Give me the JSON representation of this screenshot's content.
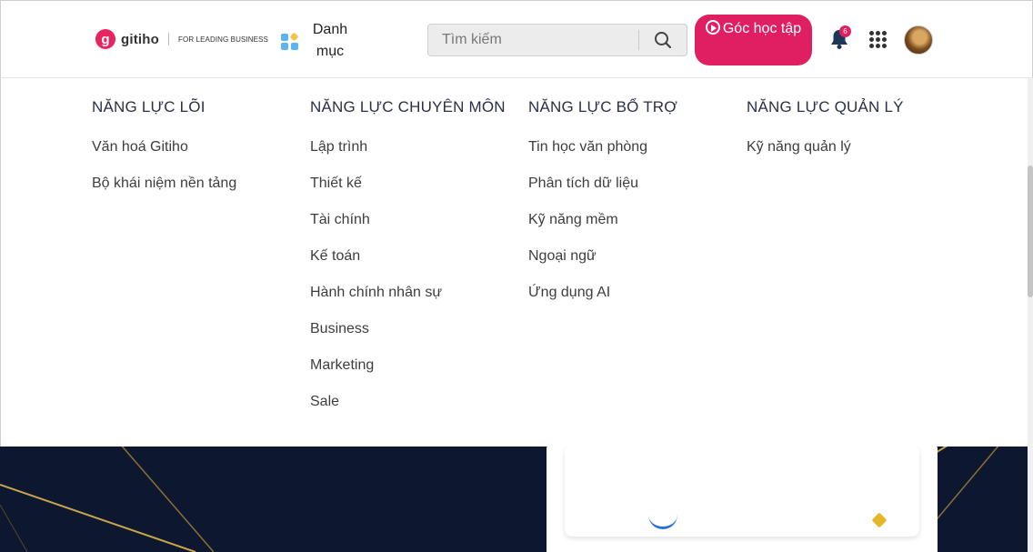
{
  "header": {
    "logo_text": "gitiho",
    "logo_mark": "g",
    "logo_tagline": "FOR LEADING BUSINESS",
    "category_label": "Danh mục",
    "search": {
      "placeholder": "Tìm kiếm",
      "value": ""
    },
    "study_button_label": "Góc học tập",
    "notification_count": "6",
    "icons": {
      "category": "category-grid-icon",
      "search": "search-icon",
      "study": "play-circle-icon",
      "notifications": "bell-icon",
      "apps": "apps-grid-icon"
    },
    "colors": {
      "accent": "#e01f63",
      "category_icon": "#5bb4f3"
    }
  },
  "menu": {
    "columns": [
      {
        "heading": "NĂNG LỰC LÕI",
        "items": [
          "Văn hoá Gitiho",
          "Bộ khái niệm nền tảng"
        ]
      },
      {
        "heading": "NĂNG LỰC CHUYÊN MÔN",
        "items": [
          "Lập trình",
          "Thiết kế",
          "Tài chính",
          "Kế toán",
          "Hành chính nhân sự",
          "Business",
          "Marketing",
          "Sale"
        ]
      },
      {
        "heading": "NĂNG LỰC BỔ TRỢ",
        "items": [
          "Tin học văn phòng",
          "Phân tích dữ liệu",
          "Kỹ năng mềm",
          "Ngoại ngữ",
          "Ứng dụng AI"
        ]
      },
      {
        "heading": "NĂNG LỰC QUẢN LÝ",
        "items": [
          "Kỹ năng quản lý"
        ]
      }
    ]
  }
}
